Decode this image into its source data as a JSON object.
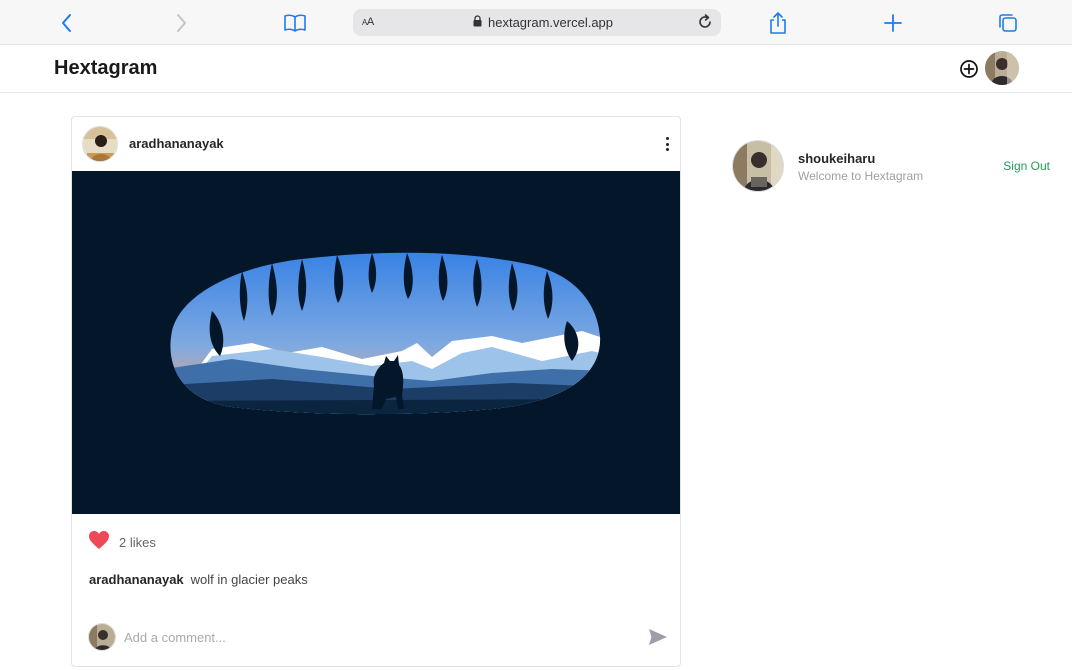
{
  "browser": {
    "address_aa": "AA",
    "url": "hextagram.vercel.app",
    "icons": [
      "chevron-left-icon",
      "chevron-right-icon",
      "book-icon",
      "lock-icon",
      "reload-icon",
      "share-icon",
      "plus-icon",
      "tabs-icon"
    ]
  },
  "header": {
    "brand": "Hextagram",
    "icons": [
      "add-circle-icon",
      "avatar"
    ]
  },
  "post": {
    "username": "aradhananayak",
    "likes": "2 likes",
    "caption_user": "aradhananayak",
    "caption_text": "wolf in glacier peaks",
    "comment_placeholder": "Add a comment...",
    "like_color": "#ed4956"
  },
  "sidebar": {
    "username": "shoukeiharu",
    "subtitle": "Welcome to Hextagram",
    "signout": "Sign Out",
    "signout_color": "#1f9d5a"
  },
  "colors": {
    "accent_blue": "#1a7cf4",
    "image_bg": "#04172a"
  }
}
